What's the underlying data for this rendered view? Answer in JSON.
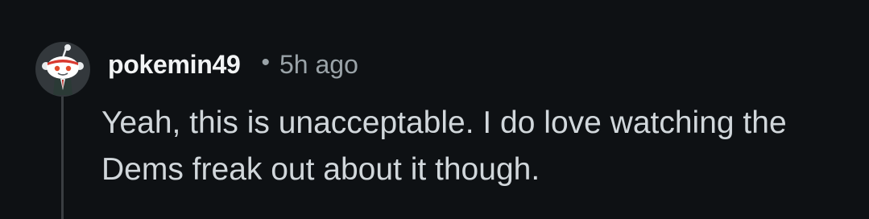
{
  "comment": {
    "author": "pokemin49",
    "separator": "•",
    "time": "5h ago",
    "text": "Yeah, this is unacceptable. I do love watching the Dems freak out about it though."
  },
  "colors": {
    "background": "#0e1114",
    "username": "#f2f4f5",
    "meta": "#9aa3a8",
    "body": "#d1d7db",
    "thread_line": "#3a3e42"
  },
  "icons": {
    "avatar": "reddit-snoo-avatar-icon"
  }
}
